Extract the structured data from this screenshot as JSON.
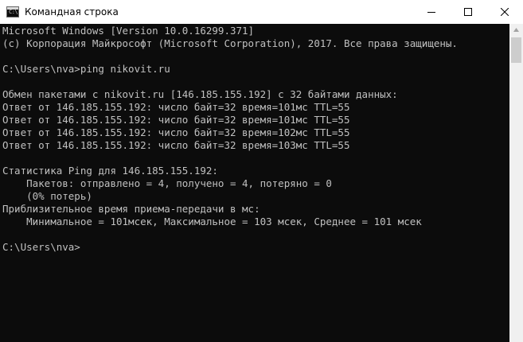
{
  "window": {
    "title": "Командная строка",
    "app_icon": "cmd-icon",
    "app_icon_glyph": "C:\\",
    "controls": [
      "minimize-icon",
      "maximize-icon",
      "close-icon"
    ]
  },
  "console": {
    "lines": [
      "Microsoft Windows [Version 10.0.16299.371]",
      "(c) Корпорация Майкрософт (Microsoft Corporation), 2017. Все права защищены.",
      "",
      "C:\\Users\\nva>ping nikovit.ru",
      "",
      "Обмен пакетами с nikovit.ru [146.185.155.192] с 32 байтами данных:",
      "Ответ от 146.185.155.192: число байт=32 время=101мс TTL=55",
      "Ответ от 146.185.155.192: число байт=32 время=101мс TTL=55",
      "Ответ от 146.185.155.192: число байт=32 время=102мс TTL=55",
      "Ответ от 146.185.155.192: число байт=32 время=103мс TTL=55",
      "",
      "Статистика Ping для 146.185.155.192:",
      "    Пакетов: отправлено = 4, получено = 4, потеряно = 0",
      "    (0% потерь)",
      "Приблизительное время приема-передачи в мс:",
      "    Минимальное = 101мсек, Максимальное = 103 мсек, Среднее = 101 мсек",
      "",
      "C:\\Users\\nva>"
    ]
  },
  "colors": {
    "console_background": "#0c0c0c",
    "console_text": "#c0c0c0",
    "titlebar_background": "#ffffff",
    "scrollbar_track": "#f0f0f0",
    "scrollbar_thumb": "#cdcdcd"
  },
  "scrollbar": {
    "arrow_icon": "scroll-up-arrow-icon"
  }
}
